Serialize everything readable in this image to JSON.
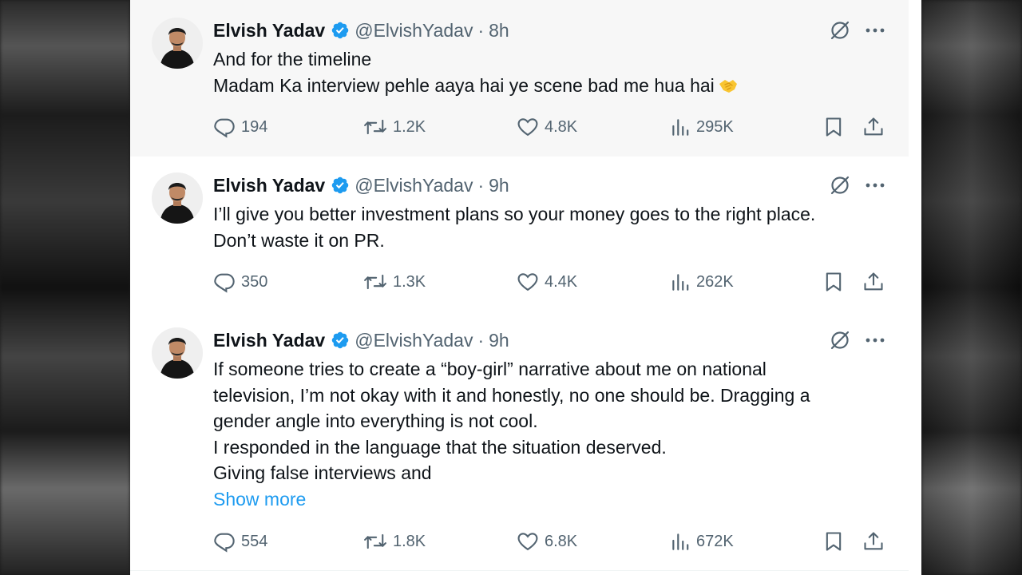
{
  "colors": {
    "verified_blue": "#1d9bf0",
    "link_blue": "#1d9bf0",
    "text_primary": "#0f1419",
    "text_secondary": "#536471",
    "emoji_yellow": "#f9c532"
  },
  "icons": {
    "verified": "verified-badge-icon",
    "grok": "grok-icon",
    "more": "more-icon",
    "reply": "reply-icon",
    "retweet": "retweet-icon",
    "like": "like-icon",
    "views": "views-icon",
    "bookmark": "bookmark-icon",
    "share": "share-icon"
  },
  "tweets": [
    {
      "name": "Elvish Yadav",
      "handle": "@ElvishYadav",
      "separator": "·",
      "time": "8h",
      "lines": [
        "And for the timeline",
        "Madam Ka interview pehle aaya hai ye scene bad me hua hai"
      ],
      "emoji": "handshake",
      "replies": "194",
      "retweets": "1.2K",
      "likes": "4.8K",
      "views": "295K"
    },
    {
      "name": "Elvish Yadav",
      "handle": "@ElvishYadav",
      "separator": "·",
      "time": "9h",
      "lines": [
        "I’ll give you better investment plans so your money goes to the right place.",
        "Don’t waste it on PR."
      ],
      "replies": "350",
      "retweets": "1.3K",
      "likes": "4.4K",
      "views": "262K"
    },
    {
      "name": "Elvish Yadav",
      "handle": "@ElvishYadav",
      "separator": "·",
      "time": "9h",
      "lines": [
        "If someone tries to create a “boy-girl” narrative about me on national",
        "television, I’m not okay with it and honestly, no one should be. Dragging a",
        "gender angle into everything is not cool.",
        "I responded in the language that the situation deserved.",
        "Giving false interviews and"
      ],
      "show_more": "Show more",
      "replies": "554",
      "retweets": "1.8K",
      "likes": "6.8K",
      "views": "672K"
    }
  ]
}
